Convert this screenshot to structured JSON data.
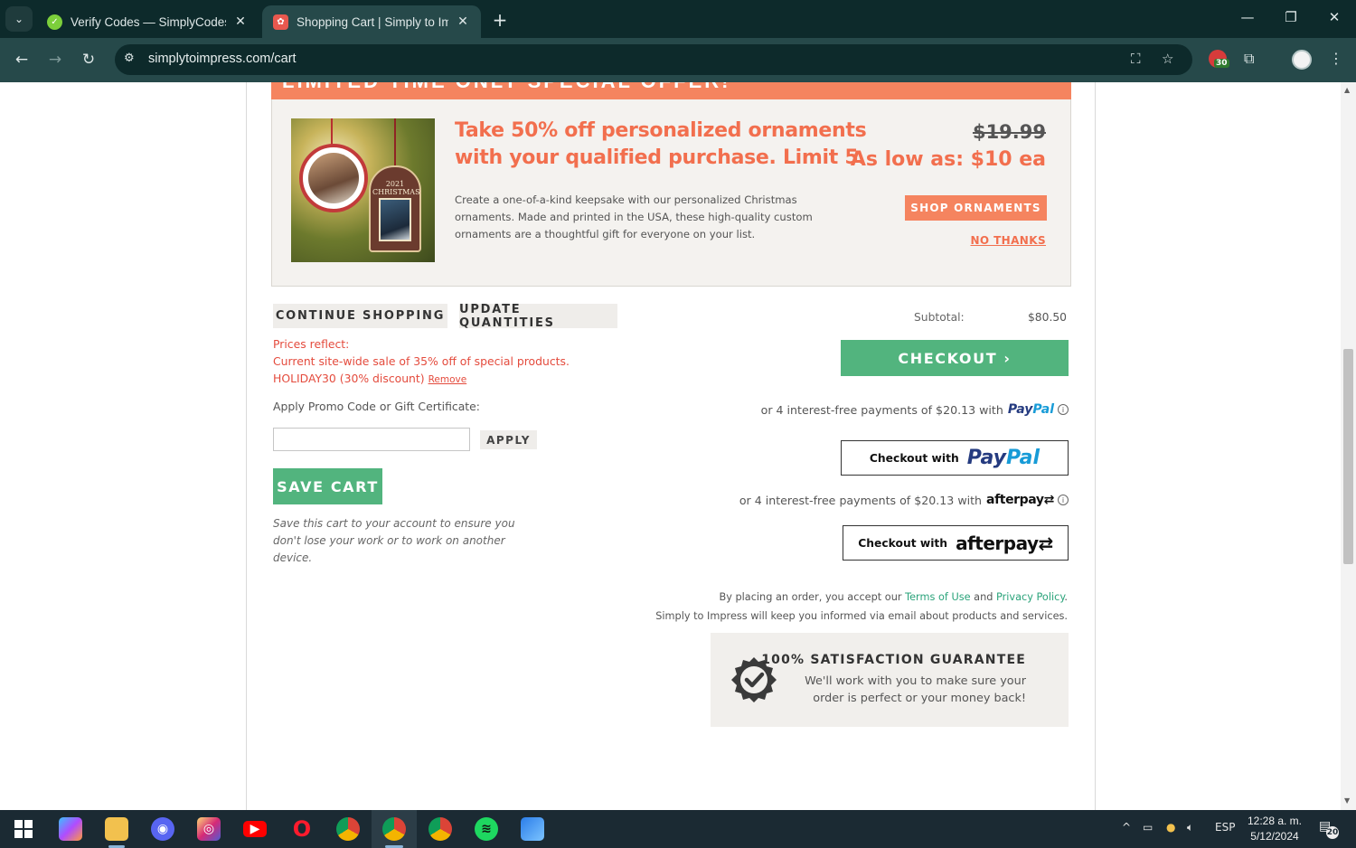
{
  "browser": {
    "tabs": [
      {
        "title": "Verify Codes — SimplyCodes",
        "active": false
      },
      {
        "title": "Shopping Cart | Simply to Impress",
        "active": true
      }
    ],
    "url": "simplytoimpress.com/cart",
    "extension_badge": "30"
  },
  "promo": {
    "band_title": "LIMITED TIME ONLY SPECIAL OFFER!",
    "headline": "Take 50% off personalized ornaments with your qualified purchase. Limit 5.",
    "description": "Create a one-of-a-kind keepsake with our personalized Christmas ornaments. Made and printed in the USA, these high-quality custom ornaments are a thoughtful gift for everyone on your list.",
    "old_price": "$19.99",
    "low_price": "As low as: $10 ea",
    "shop_button": "SHOP ORNAMENTS",
    "no_thanks": "NO THANKS",
    "ornament_year": "2021",
    "ornament_text": "CHRISTMAS"
  },
  "cart": {
    "continue_shopping": "CONTINUE SHOPPING",
    "update_quantities": "UPDATE QUANTITIES",
    "prices_reflect": "Prices reflect:",
    "sale_note": "Current site-wide sale of 35% off of special products.",
    "code_note": "HOLIDAY30 (30% discount)",
    "remove_link": "Remove",
    "promo_label": "Apply Promo Code or Gift Certificate:",
    "promo_value": "",
    "apply_button": "APPLY",
    "save_cart": "SAVE CART",
    "save_note": "Save this cart to your account to ensure you don't lose your work or to work on another device."
  },
  "summary": {
    "subtotal_label": "Subtotal:",
    "subtotal_value": "$80.50",
    "checkout_button": "CHECKOUT ›",
    "paypal_line": "or 4 interest-free payments of $20.13 with",
    "paypal_brand_a": "Pay",
    "paypal_brand_b": "Pal",
    "checkout_with": "Checkout with",
    "afterpay_line": "or 4 interest-free payments of $20.13 with",
    "afterpay_brand": "afterpay",
    "terms_prefix": "By placing an order, you accept our",
    "terms_link": "Terms of Use",
    "terms_and": "and",
    "privacy_link": "Privacy Policy",
    "terms_suffix": ".",
    "inform_note": "Simply to Impress will keep you informed via email about products and services.",
    "guarantee_title": "100% SATISFACTION GUARANTEE",
    "guarantee_text": "We'll work with you to make sure your order is perfect or your money back!"
  },
  "taskbar": {
    "language": "ESP",
    "time": "12:28 a. m.",
    "date": "5/12/2024",
    "notifications": "20"
  },
  "colors": {
    "accent_green": "#52b47e",
    "promo_orange": "#f5845f",
    "promo_text": "#f26f4e",
    "note_red": "#e44b3d",
    "paypal_dark": "#253b80",
    "paypal_light": "#179bd7"
  }
}
